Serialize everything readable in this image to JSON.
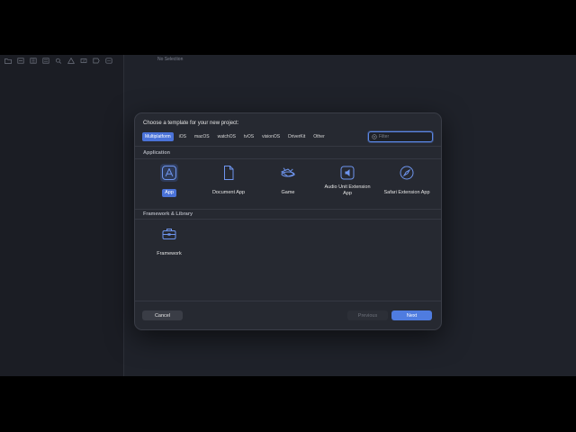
{
  "editor": {
    "status": "No Selection"
  },
  "navigator": {
    "toolbar_icons": [
      "folder-icon",
      "source-control-icon",
      "bookmark-icon",
      "find-icon",
      "issue-icon",
      "test-icon",
      "debug-icon",
      "breakpoint-icon",
      "report-icon"
    ]
  },
  "dialog": {
    "title": "Choose a template for your new project:",
    "platform_tabs": [
      "Multiplatform",
      "iOS",
      "macOS",
      "watchOS",
      "tvOS",
      "visionOS",
      "DriverKit",
      "Other"
    ],
    "selected_tab": "Multiplatform",
    "filter": {
      "placeholder": "Filter",
      "value": ""
    },
    "sections": {
      "application": {
        "title": "Application",
        "templates": [
          {
            "label": "App",
            "icon": "app-store-icon",
            "selected": true
          },
          {
            "label": "Document App",
            "icon": "document-icon"
          },
          {
            "label": "Game",
            "icon": "spaceship-icon"
          },
          {
            "label": "Audio Unit Extension App",
            "icon": "audio-unit-icon"
          },
          {
            "label": "Safari Extension App",
            "icon": "compass-icon"
          }
        ]
      },
      "framework": {
        "title": "Framework & Library",
        "templates": [
          {
            "label": "Framework",
            "icon": "toolbox-icon"
          }
        ]
      }
    },
    "buttons": {
      "cancel": "Cancel",
      "previous": "Previous",
      "next": "Next"
    }
  },
  "colors": {
    "accent": "#4f7ce0",
    "background": "#1f222a",
    "dialog": "#262931"
  }
}
